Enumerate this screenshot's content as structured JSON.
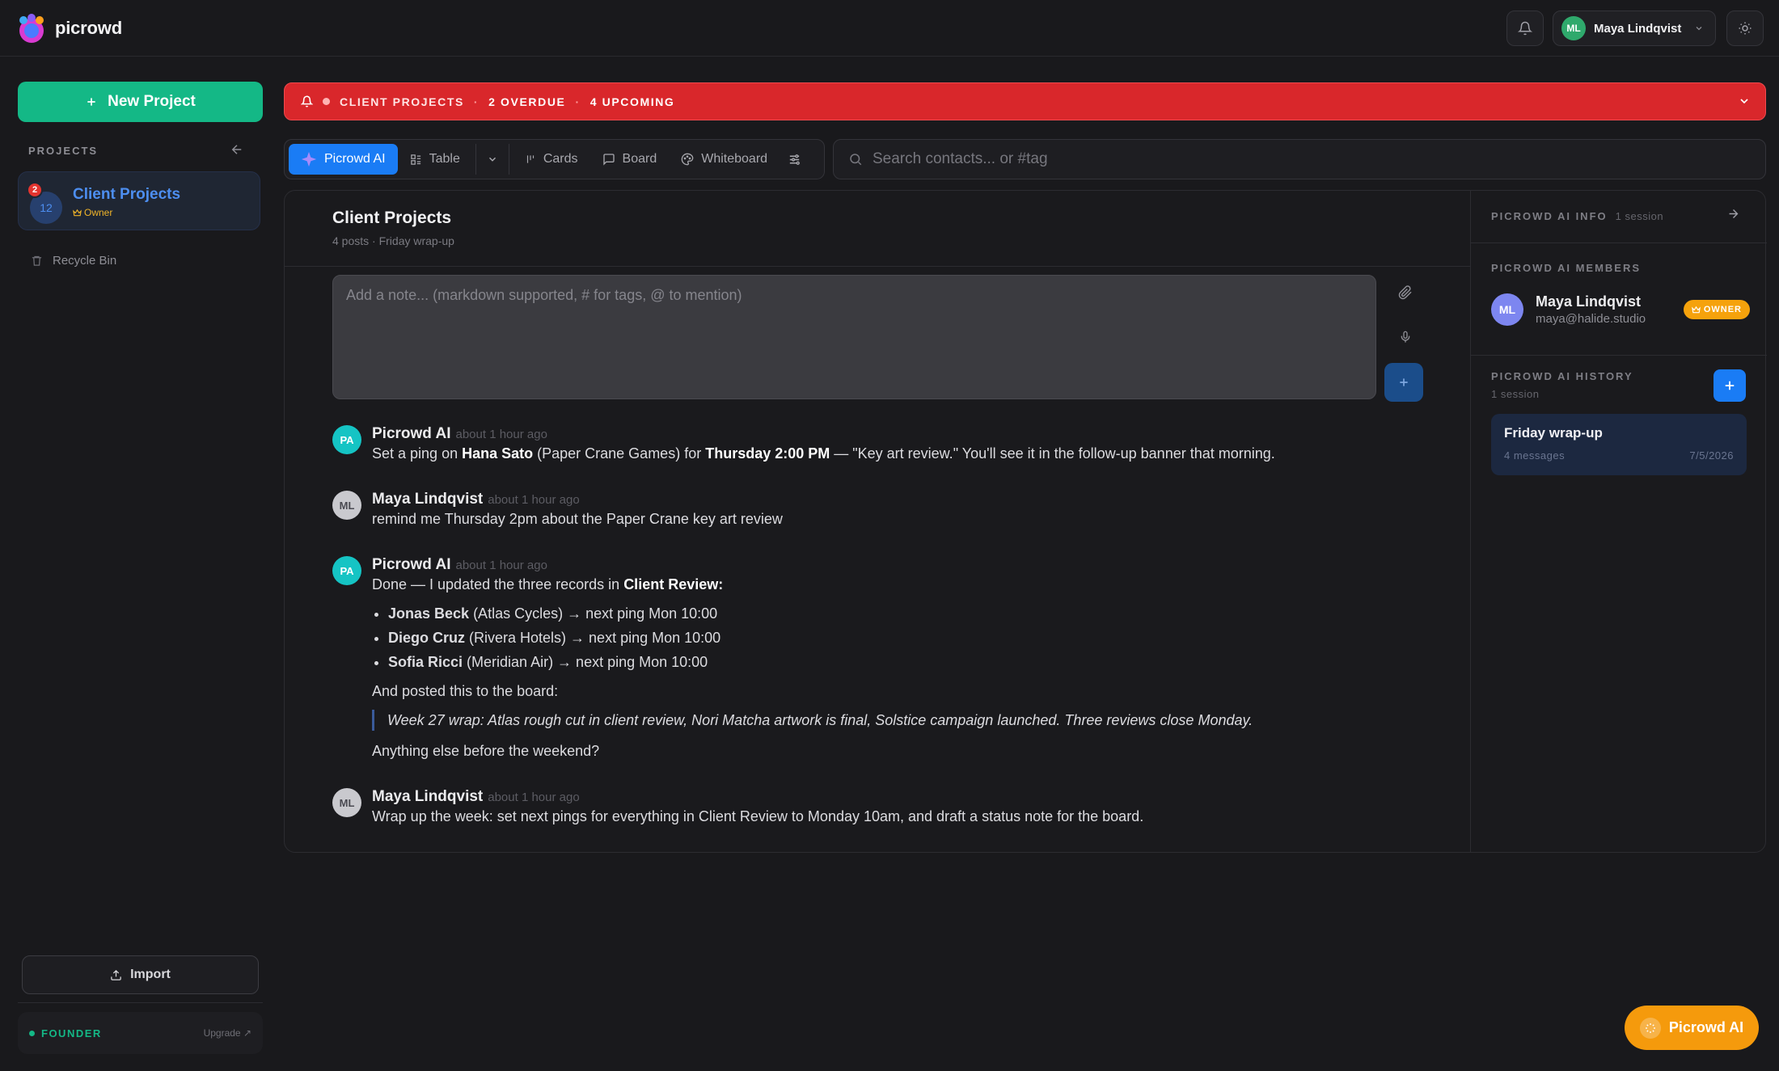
{
  "app": {
    "name": "picrowd"
  },
  "header": {
    "user_initials": "ML",
    "user_name": "Maya Lindqvist"
  },
  "sidebar": {
    "new_project_label": "New Project",
    "projects_label": "PROJECTS",
    "project": {
      "badge": "12",
      "notifications": "2",
      "title": "Client Projects",
      "role": "Owner"
    },
    "recycle_label": "Recycle Bin",
    "import_label": "Import",
    "plan_label": "FOUNDER",
    "upgrade_label": "Upgrade ↗"
  },
  "alert": {
    "title": "CLIENT PROJECTS",
    "overdue": "2 OVERDUE",
    "upcoming": "4 UPCOMING",
    "color": "#d9272b"
  },
  "views": {
    "tabs": [
      {
        "label": "Picrowd AI",
        "icon": "sparkle-icon",
        "active": true
      },
      {
        "label": "Table",
        "icon": "table-icon"
      },
      {
        "label": "Cards",
        "icon": "cards-icon"
      },
      {
        "label": "Board",
        "icon": "board-icon"
      },
      {
        "label": "Whiteboard",
        "icon": "palette-icon"
      }
    ]
  },
  "search": {
    "placeholder": "Search contacts... or #tag"
  },
  "panel": {
    "title": "Client Projects",
    "subtitle": "4 posts · Friday wrap-up",
    "note_placeholder": "Add a note... (markdown supported, # for tags, @ to mention)"
  },
  "messages": [
    {
      "initials": "PA",
      "author": "Picrowd AI",
      "time": "about 1 hour ago",
      "parts": [
        "Set a ping on ",
        "Hana Sato",
        " (Paper Crane Games) for ",
        "Thursday 2:00 PM",
        " — \"Key art review.\" You'll see it in the follow-up banner that morning."
      ]
    },
    {
      "initials": "ML",
      "author": "Maya Lindqvist",
      "time": "about 1 hour ago",
      "text": "remind me Thursday 2pm about the Paper Crane key art review"
    },
    {
      "initials": "PA",
      "author": "Picrowd AI",
      "time": "about 1 hour ago",
      "intro_a": "Done — I updated the three records in ",
      "intro_b": "Client Review",
      "items": [
        {
          "name": "Jonas Beck",
          "rest": " (Atlas Cycles) → next ping Mon 10:00"
        },
        {
          "name": "Diego Cruz",
          "rest": " (Rivera Hotels) → next ping Mon 10:00"
        },
        {
          "name": "Sofia Ricci",
          "rest": " (Meridian Air) → next ping Mon 10:00"
        }
      ],
      "posted": "And posted this to the board:",
      "quote": "Week 27 wrap: Atlas rough cut in client review, Nori Matcha artwork is final, Solstice campaign launched. Three reviews close Monday.",
      "closing": "Anything else before the weekend?"
    },
    {
      "initials": "ML",
      "author": "Maya Lindqvist",
      "time": "about 1 hour ago",
      "text": "Wrap up the week: set next pings for everything in Client Review to Monday 10am, and draft a status note for the board."
    }
  ],
  "info": {
    "info_label": "PICROWD AI INFO",
    "info_count": "1 session",
    "members_label": "PICROWD AI MEMBERS",
    "member": {
      "initials": "ML",
      "name": "Maya Lindqvist",
      "email": "maya@halide.studio",
      "role": "OWNER"
    },
    "history_label": "PICROWD AI HISTORY",
    "history_count": "1 session",
    "session": {
      "title": "Friday wrap-up",
      "messages": "4 messages",
      "date": "7/5/2026"
    }
  },
  "fab": {
    "label": "Picrowd AI"
  },
  "colors": {
    "accent": "#1a7cf5",
    "brand_green": "#14b886",
    "owner": "#f5a20c",
    "alert": "#d9272b"
  }
}
